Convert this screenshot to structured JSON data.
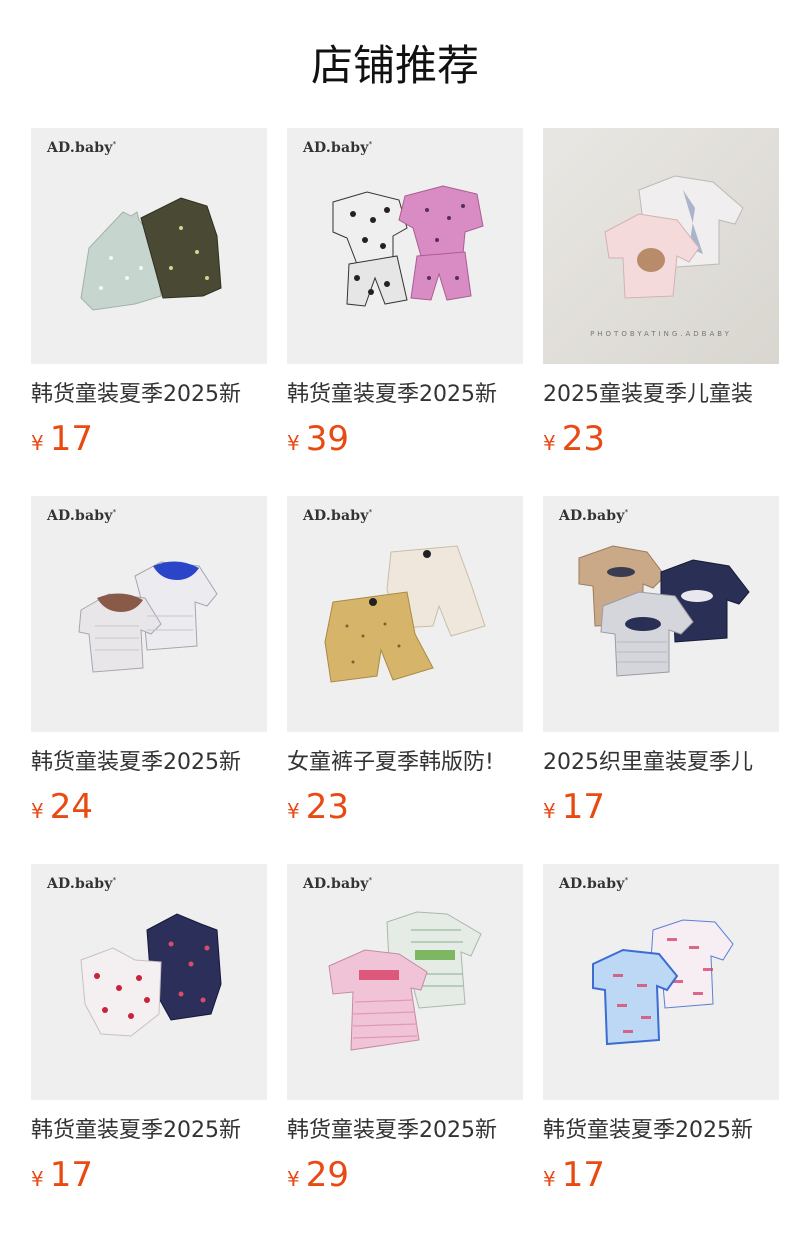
{
  "section": {
    "title": "店铺推荐"
  },
  "products": [
    {
      "brand": "AD.baby",
      "brand_mark": "*",
      "name": "韩货童装夏季2025新",
      "currency": "¥",
      "price": "17",
      "image": "floral-camisole-tops-icon"
    },
    {
      "brand": "AD.baby",
      "brand_mark": "*",
      "name": "韩货童装夏季2025新",
      "currency": "¥",
      "price": "39",
      "image": "polka-dot-sets-icon"
    },
    {
      "brand": "",
      "brand_mark": "",
      "name": "2025童装夏季儿童装",
      "currency": "¥",
      "price": "23",
      "image": "printed-tees-photo-icon",
      "photo_caption": "PHOTOBYATING.ADBABY"
    },
    {
      "brand": "AD.baby",
      "brand_mark": "*",
      "name": "韩货童装夏季2025新",
      "currency": "¥",
      "price": "24",
      "image": "ruffle-collar-tees-icon"
    },
    {
      "brand": "AD.baby",
      "brand_mark": "*",
      "name": "女童裤子夏季韩版防!",
      "currency": "¥",
      "price": "23",
      "image": "shorts-icon"
    },
    {
      "brand": "AD.baby",
      "brand_mark": "*",
      "name": "2025织里童装夏季儿",
      "currency": "¥",
      "price": "17",
      "image": "couleur-tees-icon"
    },
    {
      "brand": "AD.baby",
      "brand_mark": "*",
      "name": "韩货童装夏季2025新",
      "currency": "¥",
      "price": "17",
      "image": "cherry-print-tops-icon"
    },
    {
      "brand": "AD.baby",
      "brand_mark": "*",
      "name": "韩货童装夏季2025新",
      "currency": "¥",
      "price": "29",
      "image": "apple-avocado-dresses-icon"
    },
    {
      "brand": "AD.baby",
      "brand_mark": "*",
      "name": "韩货童装夏季2025新",
      "currency": "¥",
      "price": "17",
      "image": "pattern-tees-icon"
    }
  ],
  "colors": {
    "price": "#e84a11",
    "title": "#111111",
    "text": "#333333",
    "thumb_bg": "#efefef"
  }
}
